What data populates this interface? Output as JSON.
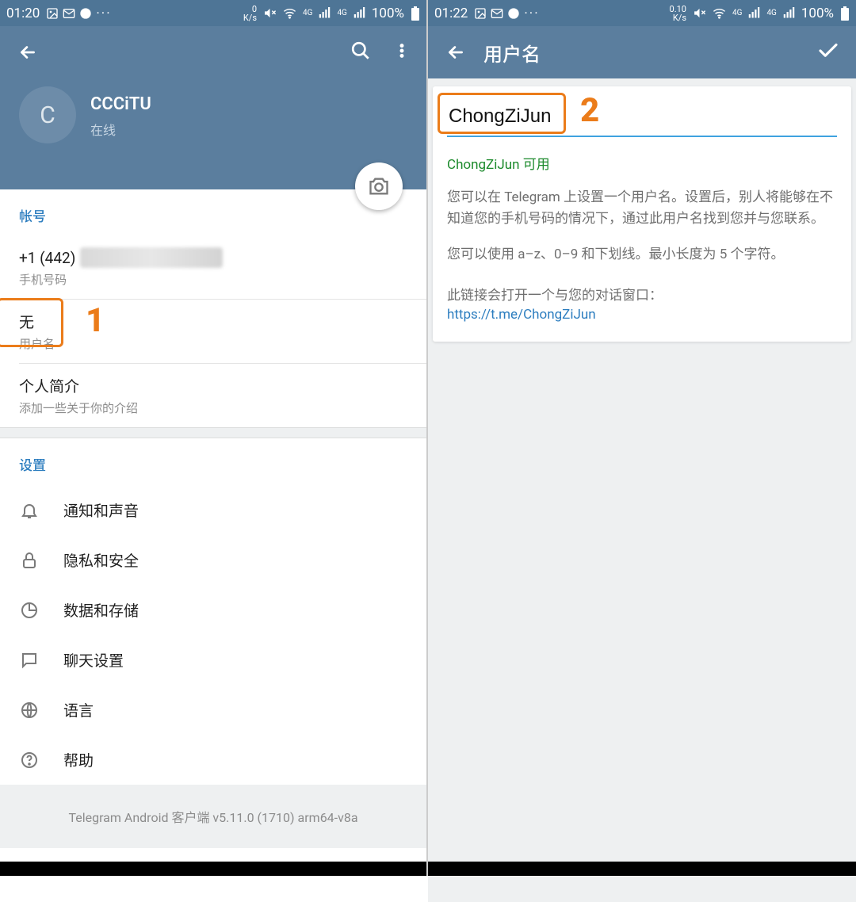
{
  "left": {
    "status": {
      "time": "01:20",
      "netspeed_top": "0",
      "netspeed_bottom": "K/s",
      "battery": "100%"
    },
    "profile": {
      "avatar_initial": "C",
      "name": "CCCiTU",
      "status": "在线"
    },
    "account_header": "帐号",
    "phone": {
      "value": "+1 (442)",
      "label": "手机号码"
    },
    "username": {
      "value": "无",
      "label": "用户名"
    },
    "bio": {
      "value": "个人简介",
      "label": "添加一些关于你的介绍"
    },
    "settings_header": "设置",
    "settings": [
      {
        "label": "通知和声音"
      },
      {
        "label": "隐私和安全"
      },
      {
        "label": "数据和存储"
      },
      {
        "label": "聊天设置"
      },
      {
        "label": "语言"
      },
      {
        "label": "帮助"
      }
    ],
    "version": "Telegram Android 客户端 v5.11.0 (1710) arm64-v8a"
  },
  "right": {
    "status": {
      "time": "01:22",
      "netspeed_top": "0.10",
      "netspeed_bottom": "K/s",
      "battery": "100%"
    },
    "toolbar_title": "用户名",
    "input_value": "ChongZiJun",
    "available_text": "ChongZiJun 可用",
    "help_text_1": "您可以在 Telegram 上设置一个用户名。设置后，别人将能够在不知道您的手机号码的情况下，通过此用户名找到您并与您联系。",
    "help_text_2": "您可以使用 a–z、0–9 和下划线。最小长度为 5 个字符。",
    "link_label": "此链接会打开一个与您的对话窗口：",
    "link_url": "https://t.me/ChongZiJun"
  },
  "annotations": {
    "num1": "1",
    "num2": "2"
  }
}
